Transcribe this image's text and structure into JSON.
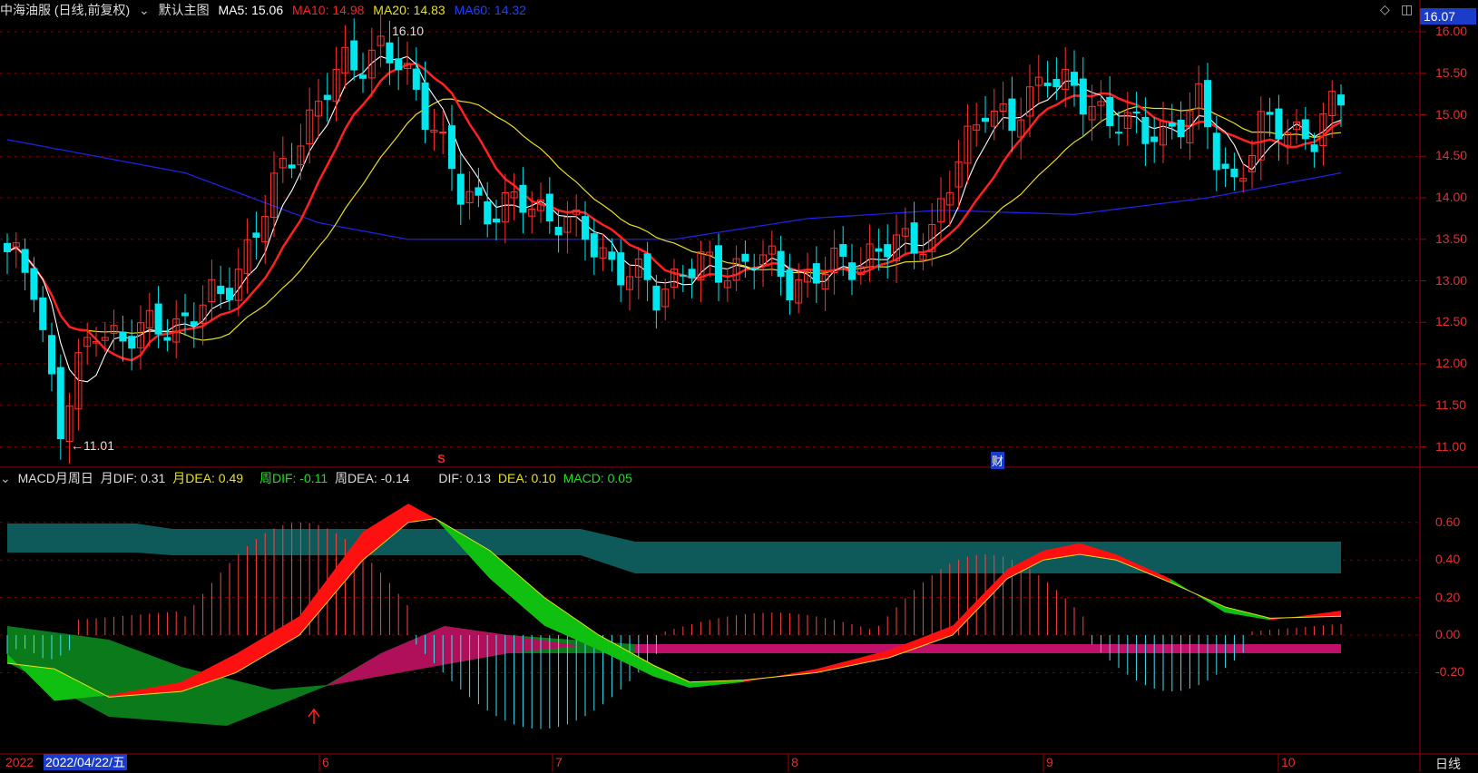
{
  "header": {
    "stock_name": "中海油服 (日线,前复权)",
    "template_label": "默认主图",
    "ma5": "MA5: 15.06",
    "ma10": "MA10: 14.98",
    "ma20": "MA20: 14.83",
    "ma60": "MA60: 14.32",
    "current_price": "16.07"
  },
  "colors": {
    "ma5": "#ffffff",
    "ma10": "#ff2020",
    "ma20": "#e8e020",
    "ma60": "#2020e0",
    "up": "#ff3030",
    "down": "#00e8ee",
    "grid": "#7a0000"
  },
  "price_axis": {
    "ticks": [
      "16.00",
      "15.50",
      "15.00",
      "14.50",
      "14.00",
      "13.50",
      "13.00",
      "12.50",
      "12.00",
      "11.50",
      "11.00"
    ]
  },
  "annotations": {
    "high": "16.10",
    "low": "←11.01",
    "marker_s": "S",
    "marker_cai": "财"
  },
  "macd_header": {
    "title": "MACD月周日",
    "month_dif": "月DIF: 0.31",
    "month_dea": "月DEA: 0.49",
    "week_dif": "周DIF: -0.11",
    "week_dea": "周DEA: -0.14",
    "dif": "DIF: 0.13",
    "dea": "DEA: 0.10",
    "macd": "MACD: 0.05"
  },
  "macd_axis": {
    "ticks": [
      "0.60",
      "0.40",
      "0.20",
      "0.00",
      "-0.20"
    ]
  },
  "time_axis": {
    "start": "2022",
    "selected_date": "2022/04/22/五",
    "months": [
      "6",
      "7",
      "8",
      "9",
      "10"
    ],
    "period": "日线"
  }
}
